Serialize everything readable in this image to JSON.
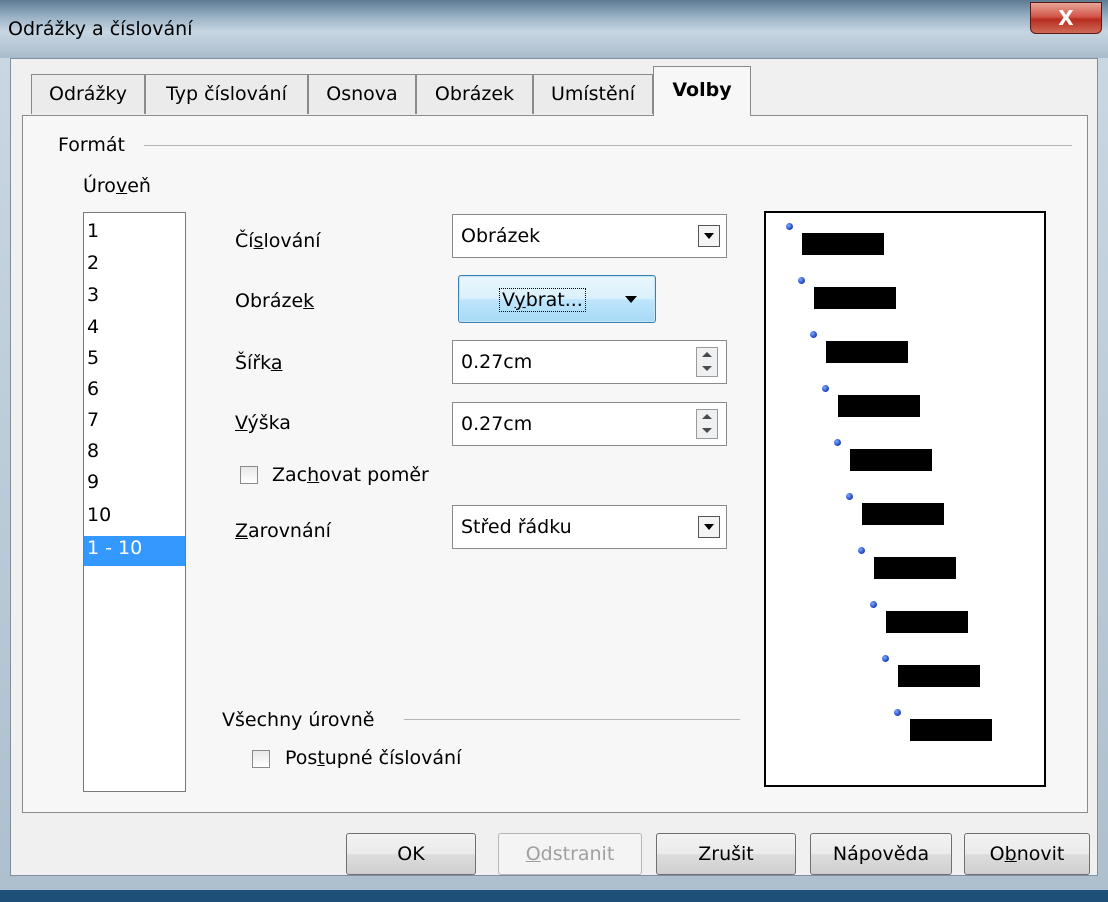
{
  "window": {
    "title": "Odrážky a číslování",
    "close_glyph": "X"
  },
  "tabs": [
    {
      "label": "Odrážky"
    },
    {
      "label": "Typ číslování"
    },
    {
      "label": "Osnova"
    },
    {
      "label": "Obrázek"
    },
    {
      "label": "Umístění"
    },
    {
      "label": "Volby",
      "active": true
    }
  ],
  "format": {
    "group_label": "Formát",
    "level_label": "Úroveň",
    "levels": [
      "1",
      "2",
      "3",
      "4",
      "5",
      "6",
      "7",
      "8",
      "9",
      "10",
      "1 - 10"
    ],
    "selected_level": "1 - 10"
  },
  "fields": {
    "numbering_label": "Číslování",
    "numbering_value": "Obrázek",
    "picture_label": "Obrázek",
    "picture_button": "Vybrat...",
    "width_label": "Šířka",
    "width_value": "0.27cm",
    "height_label": "Výška",
    "height_value": "0.27cm",
    "keep_ratio_label": "Zachovat poměr",
    "align_label": "Zarovnání",
    "align_value": "Střed řádku"
  },
  "all_levels": {
    "group_label": "Všechny úrovně",
    "consecutive_label": "Postupné číslování"
  },
  "buttons": {
    "ok": "OK",
    "remove": "Odstranit",
    "cancel": "Zrušit",
    "help": "Nápověda",
    "reset": "Obnovit"
  },
  "preview": {
    "bullet_color": "#1b3fb8",
    "level_count": 10
  },
  "icons": [
    "close-icon",
    "dropdown-arrow-icon",
    "spin-up-icon",
    "spin-down-icon",
    "checkbox-icon",
    "bullet-picture-icon"
  ]
}
